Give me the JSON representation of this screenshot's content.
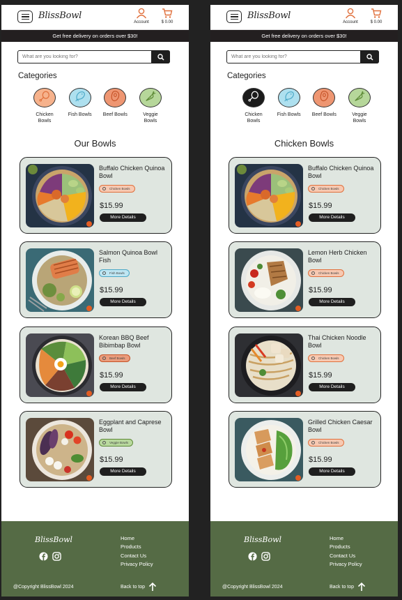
{
  "frames": [
    {
      "brand": "BlissBowl",
      "account_label": "Account",
      "cart_total": "$ 0.00",
      "promo": "Get free delivery on orders over $30!",
      "search_placeholder": "What are you looking for?",
      "categories_title": "Categories",
      "section_title": "Our Bowls",
      "categories": [
        {
          "label": "Chicken Bowls",
          "icon": "drumstick-icon",
          "fill": "#f6b28c",
          "stroke": "#e0703c",
          "active": false
        },
        {
          "label": "Fish Bowls",
          "icon": "fish-icon",
          "fill": "#aee0ef",
          "stroke": "#4ba8c7",
          "active": false
        },
        {
          "label": "Beef Bowls",
          "icon": "steak-icon",
          "fill": "#ee9672",
          "stroke": "#c65226",
          "active": false
        },
        {
          "label": "Veggie Bowls",
          "icon": "carrot-icon",
          "fill": "#b6d79a",
          "stroke": "#5d8a36",
          "active": false
        }
      ],
      "products": [
        {
          "name": "Buffalo Chicken Quinoa Bowl",
          "tag": "Chicken Bowls",
          "tag_type": "chicken",
          "price": "$15.99",
          "button": "More Details"
        },
        {
          "name": "Salmon Quinoa Bowl Fish",
          "tag": "Fish Bowls",
          "tag_type": "fish",
          "price": "$15.99",
          "button": "More Details"
        },
        {
          "name": "Korean BBQ Beef Bibimbap Bowl",
          "tag": "Beef Bowls",
          "tag_type": "beef",
          "price": "$15.99",
          "button": "More Details"
        },
        {
          "name": "Eggplant and Caprese Bowl",
          "tag": "Veggie Bowls",
          "tag_type": "veggie",
          "price": "$15.99",
          "button": "More Details"
        }
      ],
      "footer": {
        "brand": "BlissBowl",
        "links": [
          "Home",
          "Products",
          "Contact Us",
          "Privacy Policy"
        ],
        "copyright": "@Copyright BlissBowl 2024",
        "back_to_top": "Back to top"
      }
    },
    {
      "brand": "BlissBowl",
      "account_label": "Account",
      "cart_total": "$ 0.00",
      "promo": "Get free delivery on orders over $30!",
      "search_placeholder": "What are you looking for?",
      "categories_title": "Categories",
      "section_title": "Chicken Bowls",
      "categories": [
        {
          "label": "Chicken Bowls",
          "icon": "drumstick-icon",
          "fill": "#1b1b1b",
          "stroke": "#ffffff",
          "active": true
        },
        {
          "label": "Fish Bowls",
          "icon": "fish-icon",
          "fill": "#aee0ef",
          "stroke": "#4ba8c7",
          "active": false
        },
        {
          "label": "Beef Bowls",
          "icon": "steak-icon",
          "fill": "#ee9672",
          "stroke": "#c65226",
          "active": false
        },
        {
          "label": "Veggie Bowls",
          "icon": "carrot-icon",
          "fill": "#b6d79a",
          "stroke": "#5d8a36",
          "active": false
        }
      ],
      "products": [
        {
          "name": "Buffalo Chicken Quinoa Bowl",
          "tag": "Chicken Bowls",
          "tag_type": "chicken",
          "price": "$15.99",
          "button": "More Details"
        },
        {
          "name": "Lemon Herb Chicken Bowl",
          "tag": "Chicken Bowls",
          "tag_type": "chicken",
          "price": "$15.99",
          "button": "More Details"
        },
        {
          "name": "Thai Chicken Noodle Bowl",
          "tag": "Chicken Bowls",
          "tag_type": "chicken",
          "price": "$15.99",
          "button": "More Details"
        },
        {
          "name": "Grilled Chicken Caesar Bowl",
          "tag": "Chicken Bowls",
          "tag_type": "chicken",
          "price": "$15.99",
          "button": "More Details"
        }
      ],
      "footer": {
        "brand": "BlissBowl",
        "links": [
          "Home",
          "Products",
          "Contact Us",
          "Privacy Policy"
        ],
        "copyright": "@Copyright BlissBowl 2024",
        "back_to_top": "Back to top"
      }
    }
  ],
  "colors": {
    "accent": "#e0703c",
    "dark": "#1f1f1f",
    "card_bg": "#dfe6e0",
    "footer_bg": "#556b45",
    "tag_chicken_bg": "#f7c9b2",
    "tag_chicken_border": "#e0703c",
    "tag_fish_bg": "#bfe6f2",
    "tag_fish_border": "#4ba8c7",
    "tag_beef_bg": "#ea9c7c",
    "tag_beef_border": "#c65226",
    "tag_veggie_bg": "#b9d99e",
    "tag_veggie_border": "#5d8a36"
  }
}
